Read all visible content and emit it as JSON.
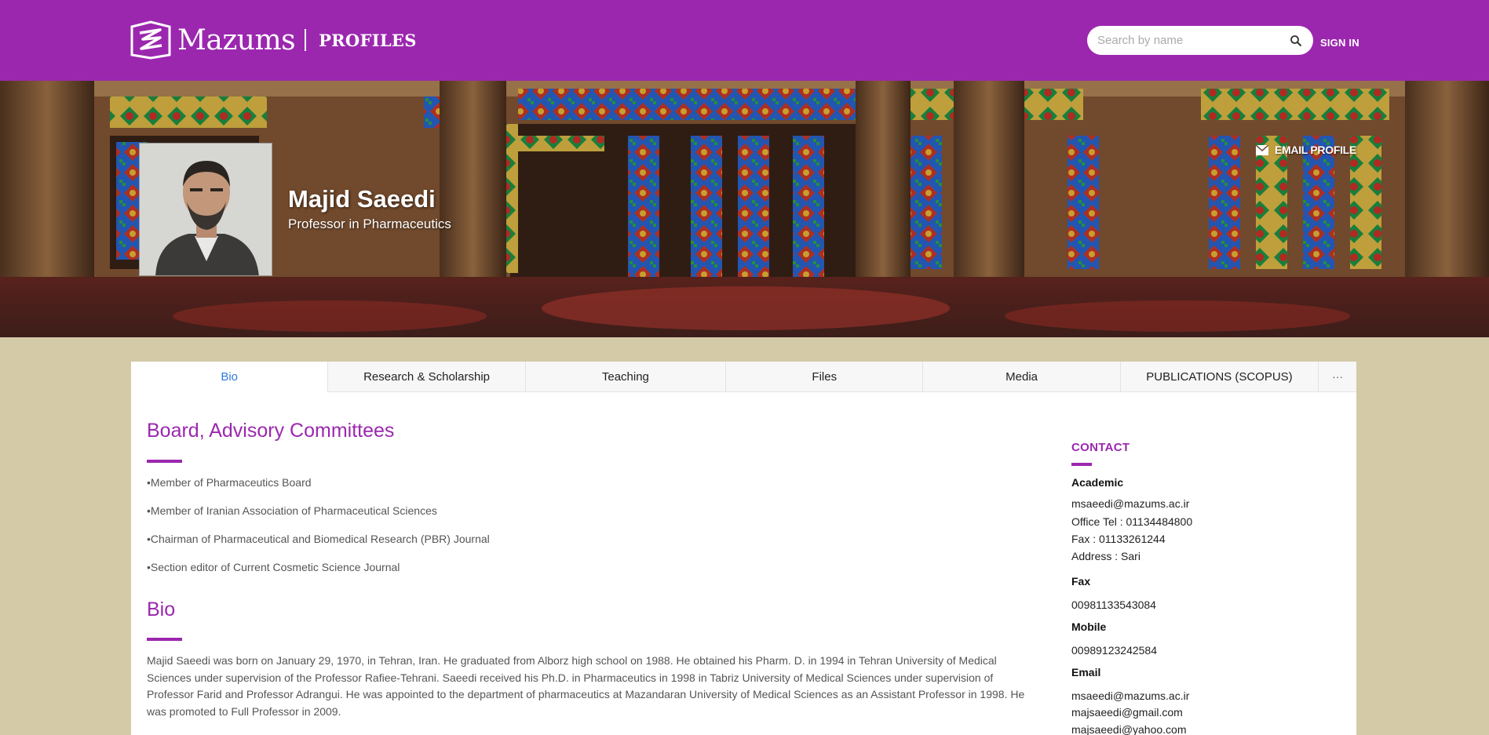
{
  "header": {
    "logo_text": "Mazums",
    "section": "PROFILES",
    "search_placeholder": "Search by name",
    "signin": "SIGN IN",
    "bg_color": "#9b27af"
  },
  "profile": {
    "name": "Majid Saeedi",
    "title": "Professor in Pharmaceutics",
    "email_profile": "EMAIL PROFILE"
  },
  "tabs": [
    {
      "label": "Bio",
      "active": true
    },
    {
      "label": "Research & Scholarship",
      "active": false
    },
    {
      "label": "Teaching",
      "active": false
    },
    {
      "label": "Files",
      "active": false
    },
    {
      "label": "Media",
      "active": false
    },
    {
      "label": "PUBLICATIONS (SCOPUS)",
      "active": false
    }
  ],
  "tab_more": "···",
  "main": {
    "board": {
      "heading": "Board, Advisory Committees",
      "items": [
        "•Member of Pharmaceutics Board",
        "•Member of Iranian Association of Pharmaceutical Sciences",
        "•Chairman of Pharmaceutical and Biomedical Research (PBR) Journal",
        "•Section editor of Current Cosmetic Science Journal"
      ]
    },
    "bio": {
      "heading": "Bio",
      "lines": [
        "Majid Saeedi was born on January 29, 1970, in Tehran, Iran. He graduated from Alborz high school on 1988. He obtained his Pharm. D. in 1994 in Tehran University of Medical",
        "Sciences under supervision of the Professor Rafiee-Tehrani. Saeedi received his Ph.D. in Pharmaceutics in 1998 in Tabriz University of Medical Sciences under supervision of",
        "Professor Farid and Professor Adrangui. He was appointed to the department of pharmaceutics at Mazandaran University of Medical Sciences as an Assistant Professor in 1998. He",
        "was promoted to Full Professor in 2009."
      ]
    }
  },
  "contact": {
    "heading": "CONTACT",
    "academic_label": "Academic",
    "academic_lines": [
      "msaeedi@mazums.ac.ir",
      "Office Tel : 01134484800",
      "Fax : 01133261244",
      "Address : Sari"
    ],
    "fax_label": "Fax",
    "fax": "00981133543084",
    "mobile_label": "Mobile",
    "mobile": "00989123242584",
    "email_label": "Email",
    "emails": [
      "msaeedi@mazums.ac.ir",
      "majsaeedi@gmail.com",
      "majsaeedi@yahoo.com"
    ]
  },
  "colors": {
    "accent": "#9b27af",
    "active_tab": "#2d7bd6",
    "page_bg": "#d4caa8"
  },
  "icons": {
    "logo": "mazums-logo-icon",
    "search": "search-icon",
    "email": "envelope-icon"
  }
}
